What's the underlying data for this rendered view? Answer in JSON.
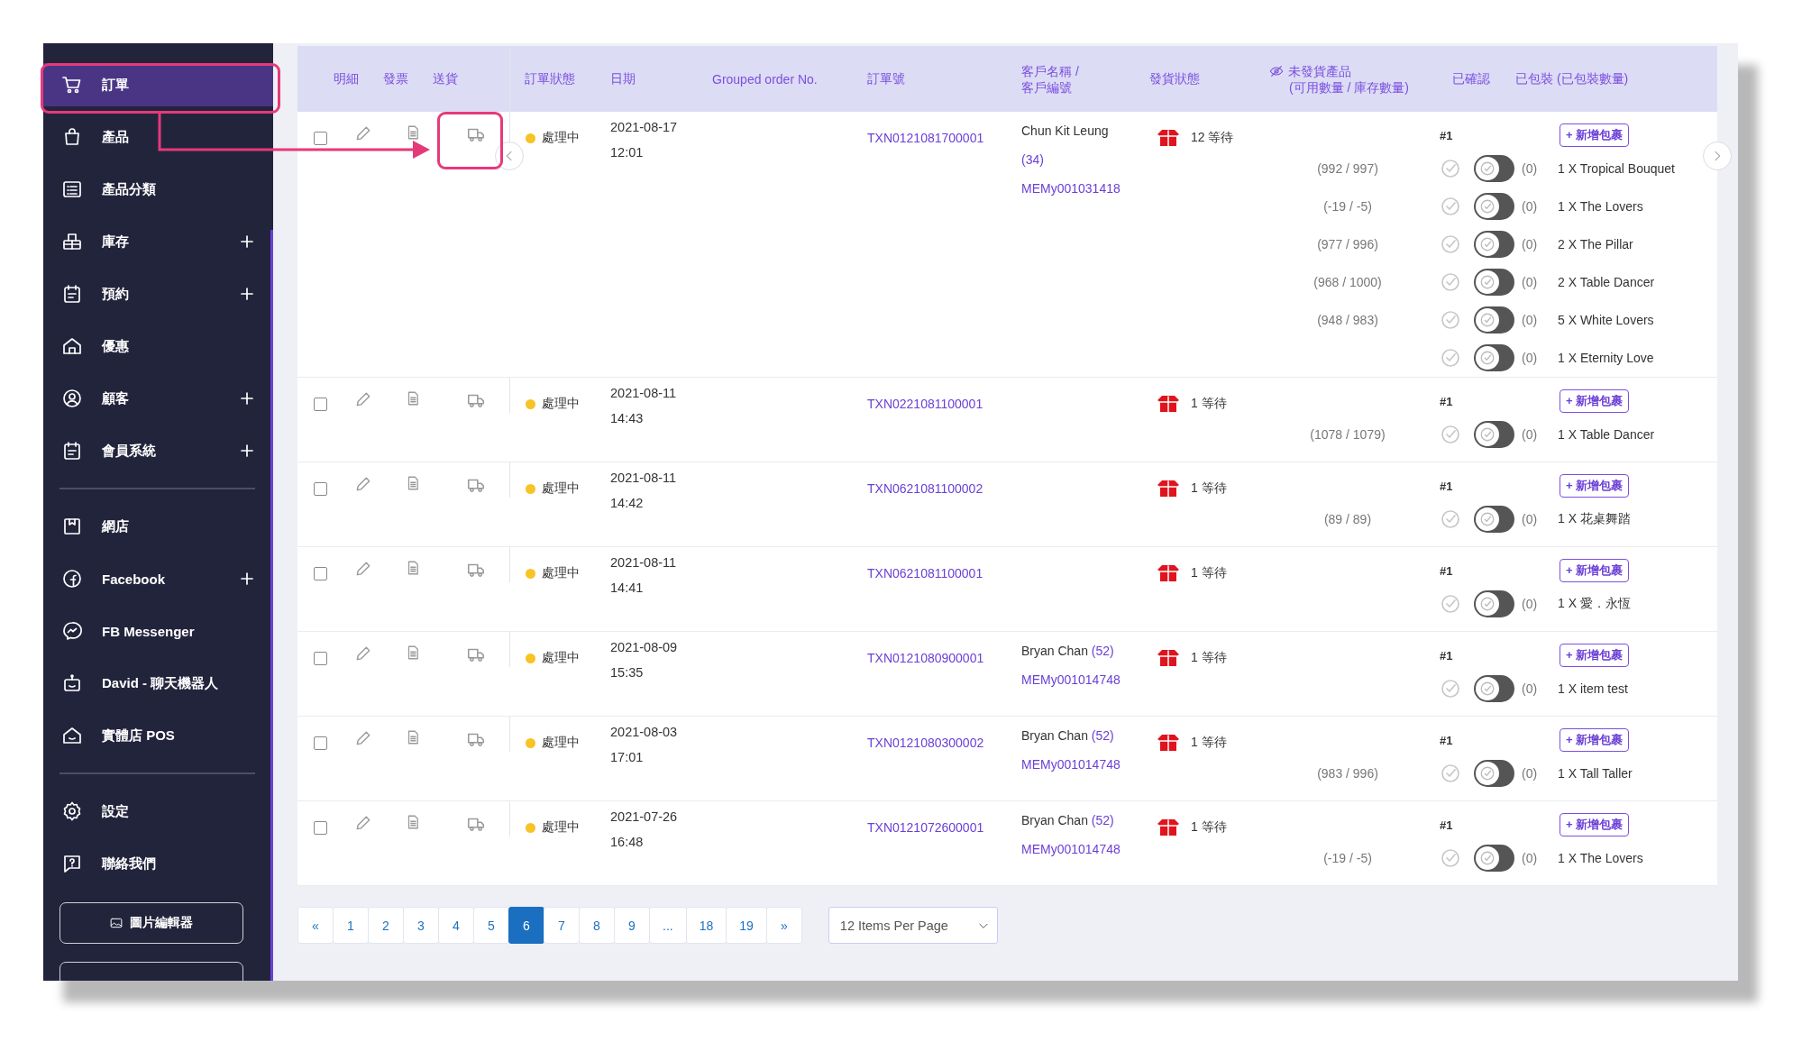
{
  "sidebar": {
    "sections": [
      {
        "items": [
          {
            "label": "訂單",
            "selected": true,
            "expandable": false
          },
          {
            "label": "產品",
            "selected": false,
            "expandable": false
          },
          {
            "label": "產品分類",
            "selected": false,
            "expandable": false
          },
          {
            "label": "庫存",
            "selected": false,
            "expandable": true
          },
          {
            "label": "預約",
            "selected": false,
            "expandable": true
          },
          {
            "label": "優惠",
            "selected": false,
            "expandable": false
          },
          {
            "label": "顧客",
            "selected": false,
            "expandable": true
          },
          {
            "label": "會員系統",
            "selected": false,
            "expandable": true
          }
        ]
      },
      {
        "items": [
          {
            "label": "網店",
            "selected": false,
            "expandable": false
          },
          {
            "label": "Facebook",
            "selected": false,
            "expandable": true
          },
          {
            "label": "FB Messenger",
            "selected": false,
            "expandable": false
          },
          {
            "label": "David - 聊天機器人",
            "selected": false,
            "expandable": false
          },
          {
            "label": "實體店 POS",
            "selected": false,
            "expandable": false
          }
        ]
      },
      {
        "items": [
          {
            "label": "設定",
            "selected": false,
            "expandable": false
          },
          {
            "label": "聯絡我們",
            "selected": false,
            "expandable": false
          }
        ]
      }
    ],
    "button": "圖片編輯器"
  },
  "table": {
    "columns": {
      "details": "明細",
      "invoice": "發票",
      "delivery": "送貨",
      "status": "訂單狀態",
      "date": "日期",
      "grouped": "Grouped order No.",
      "order_no": "訂單號",
      "customer": "客戶名稱 / 客戶編號",
      "shipping": "發貨狀態",
      "unshipped": "未發貨產品",
      "unshipped_sub": "(可用數量 / 庫存數量)",
      "confirmed": "已確認",
      "packed": "已包裝 (已包裝數量)"
    },
    "rows": [
      {
        "checked": false,
        "status": "處理中",
        "date": "2021-08-17",
        "time": "12:01",
        "order_no": "TXN0121081700001",
        "customer": {
          "name": "Chun Kit Leung",
          "count": "(34)",
          "member": "MEMy001031418"
        },
        "shipping": "12 等待",
        "package": "#1",
        "add_button": "+ 新增包裹",
        "items": [
          {
            "stock": "(992 / 997)",
            "confirmed": false,
            "packed": false,
            "packed_count": "(0)",
            "product": "1 X Tropical Bouquet"
          },
          {
            "stock": "(-19 / -5)",
            "confirmed": false,
            "packed": false,
            "packed_count": "(0)",
            "product": "1 X The Lovers"
          },
          {
            "stock": "(977 / 996)",
            "confirmed": false,
            "packed": false,
            "packed_count": "(0)",
            "product": "2 X The Pillar"
          },
          {
            "stock": "(968 / 1000)",
            "confirmed": false,
            "packed": false,
            "packed_count": "(0)",
            "product": "2 X Table Dancer"
          },
          {
            "stock": "(948 / 983)",
            "confirmed": false,
            "packed": false,
            "packed_count": "(0)",
            "product": "5 X White Lovers"
          },
          {
            "confirmed": false,
            "packed": false,
            "packed_count": "(0)",
            "product": "1 X Eternity Love"
          }
        ]
      },
      {
        "checked": false,
        "status": "處理中",
        "date": "2021-08-11",
        "time": "14:43",
        "order_no": "TXN0221081100001",
        "shipping": "1 等待",
        "package": "#1",
        "add_button": "+ 新增包裹",
        "items": [
          {
            "stock": "(1078 / 1079)",
            "confirmed": false,
            "packed": false,
            "packed_count": "(0)",
            "product": "1 X Table Dancer"
          }
        ]
      },
      {
        "checked": false,
        "status": "處理中",
        "date": "2021-08-11",
        "time": "14:42",
        "order_no": "TXN0621081100002",
        "shipping": "1 等待",
        "package": "#1",
        "add_button": "+ 新增包裹",
        "items": [
          {
            "stock": "(89 / 89)",
            "confirmed": false,
            "packed": false,
            "packed_count": "(0)",
            "product": "1 X 花桌舞踏"
          }
        ]
      },
      {
        "checked": false,
        "status": "處理中",
        "date": "2021-08-11",
        "time": "14:41",
        "order_no": "TXN0621081100001",
        "shipping": "1 等待",
        "package": "#1",
        "add_button": "+ 新增包裹",
        "items": [
          {
            "confirmed": false,
            "packed": false,
            "packed_count": "(0)",
            "product": "1 X 愛．永恆"
          }
        ]
      },
      {
        "checked": false,
        "status": "處理中",
        "date": "2021-08-09",
        "time": "15:35",
        "order_no": "TXN0121080900001",
        "customer": {
          "name": "Bryan Chan",
          "count": "(52)",
          "member": "MEMy001014748"
        },
        "shipping": "1 等待",
        "package": "#1",
        "add_button": "+ 新增包裹",
        "items": [
          {
            "confirmed": false,
            "packed": false,
            "packed_count": "(0)",
            "product": "1 X item test"
          }
        ]
      },
      {
        "checked": false,
        "status": "處理中",
        "date": "2021-08-03",
        "time": "17:01",
        "order_no": "TXN0121080300002",
        "customer": {
          "name": "Bryan Chan",
          "count": "(52)",
          "member": "MEMy001014748"
        },
        "shipping": "1 等待",
        "package": "#1",
        "add_button": "+ 新增包裹",
        "items": [
          {
            "stock": "(983 / 996)",
            "confirmed": false,
            "packed": false,
            "packed_count": "(0)",
            "product": "1 X Tall Taller"
          }
        ]
      },
      {
        "checked": false,
        "status": "處理中",
        "date": "2021-07-26",
        "time": "16:48",
        "order_no": "TXN0121072600001",
        "customer": {
          "name": "Bryan Chan",
          "count": "(52)",
          "member": "MEMy001014748"
        },
        "shipping": "1 等待",
        "package": "#1",
        "add_button": "+ 新增包裹",
        "items": [
          {
            "stock": "(-19 / -5)",
            "confirmed": false,
            "packed": false,
            "packed_count": "(0)",
            "product": "1 X The Lovers"
          }
        ]
      }
    ]
  },
  "pagination": {
    "pages": [
      {
        "label": "«",
        "selected": false
      },
      {
        "label": "1",
        "selected": false
      },
      {
        "label": "2",
        "selected": false
      },
      {
        "label": "3",
        "selected": false
      },
      {
        "label": "4",
        "selected": false
      },
      {
        "label": "5",
        "selected": false
      },
      {
        "label": "6",
        "selected": true
      },
      {
        "label": "7",
        "selected": false
      },
      {
        "label": "8",
        "selected": false
      },
      {
        "label": "9",
        "selected": false
      },
      {
        "label": "...",
        "selected": false
      },
      {
        "label": "18",
        "selected": false
      },
      {
        "label": "19",
        "selected": false
      },
      {
        "label": "»",
        "selected": false
      }
    ],
    "per_page": "12 Items Per Page"
  }
}
